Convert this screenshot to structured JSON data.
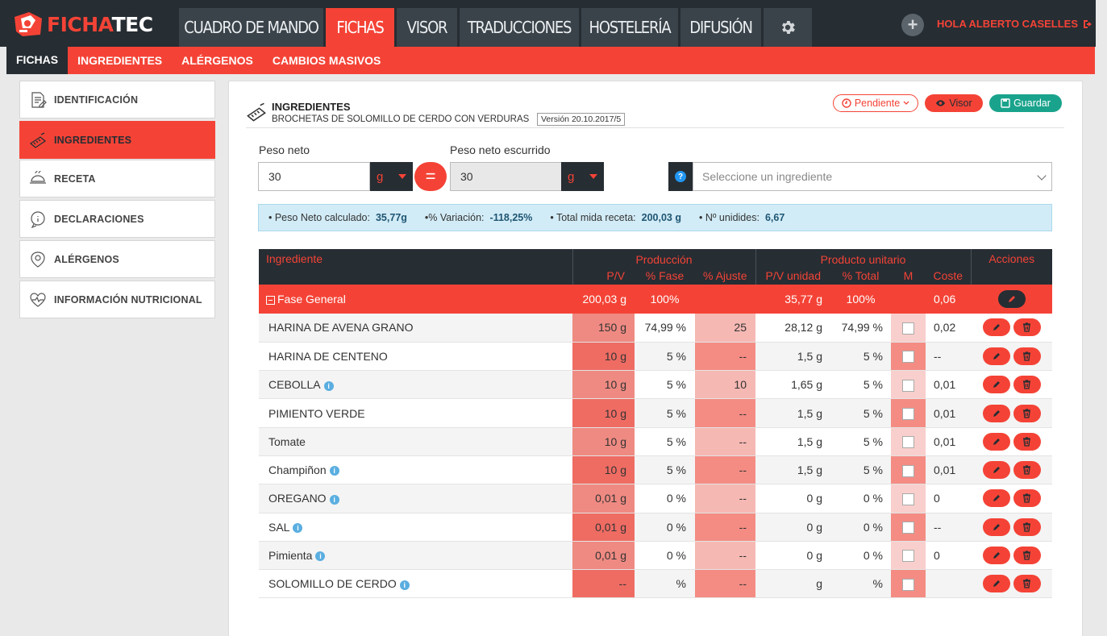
{
  "logo": {
    "part1": "FICHA",
    "part2": "TEC"
  },
  "main_nav": [
    "CUADRO DE MANDO",
    "FICHAS",
    "VISOR",
    "TRADUCCIONES",
    "HOSTELERÍA",
    "DIFUSIÓN"
  ],
  "user": {
    "greeting": "HOLA ALBERTO CASELLES"
  },
  "sub_nav": [
    "FICHAS",
    "INGREDIENTES",
    "ALÉRGENOS",
    "CAMBIOS MASIVOS"
  ],
  "sidebar": [
    "IDENTIFICACIÓN",
    "INGREDIENTES",
    "RECETA",
    "DECLARACIONES",
    "ALÉRGENOS",
    "INFORMACIÓN NUTRICIONAL"
  ],
  "header": {
    "title": "INGREDIENTES",
    "subtitle": "BROCHETAS DE SOLOMILLO DE CERDO CON VERDURAS",
    "version": "Versión 20.10.2017/5",
    "status": "Pendiente",
    "visor": "Visor",
    "guardar": "Guardar"
  },
  "form": {
    "peso_neto_label": "Peso neto",
    "peso_neto": "30",
    "unit1": "g",
    "eq": "=",
    "escurrido_label": "Peso neto escurrido",
    "escurrido": "30",
    "unit2": "g",
    "select_placeholder": "Seleccione un ingrediente"
  },
  "info": {
    "l1": "• Peso Neto calculado:",
    "v1": "35,77g",
    "l2": "•% Variación:",
    "v2": "-118,25%",
    "l3": "• Total mida receta:",
    "v3": "200,03 g",
    "l4": "• Nº unidides:",
    "v4": "6,67"
  },
  "table": {
    "h_ingrediente": "Ingrediente",
    "h_produccion": "Producción",
    "h_producto": "Producto unitario",
    "h_acciones": "Acciones",
    "h_pv": "P/V",
    "h_fase": "% Fase",
    "h_ajuste": "% Ajuste",
    "h_pvu": "P/V unidad",
    "h_total": "% Total",
    "h_m": "M",
    "h_coste": "Coste",
    "fase": {
      "name": "Fase General",
      "pv": "200,03 g",
      "fase": "100%",
      "pvu": "35,77 g",
      "total": "100%",
      "coste": "0,06"
    },
    "rows": [
      {
        "name": "HARINA DE AVENA GRANO",
        "pv": "150 g",
        "fase": "74,99 %",
        "ajuste": "25",
        "pvu": "28,12 g",
        "total": "74,99 %",
        "coste": "0,02"
      },
      {
        "name": "HARINA DE CENTENO",
        "pv": "10 g",
        "fase": "5 %",
        "ajuste": "--",
        "pvu": "1,5 g",
        "total": "5 %",
        "coste": "--"
      },
      {
        "name": "CEBOLLA",
        "pv": "10 g",
        "fase": "5 %",
        "ajuste": "10",
        "pvu": "1,65 g",
        "total": "5 %",
        "coste": "0,01"
      },
      {
        "name": "PIMIENTO VERDE",
        "pv": "10 g",
        "fase": "5 %",
        "ajuste": "--",
        "pvu": "1,5 g",
        "total": "5 %",
        "coste": "0,01"
      },
      {
        "name": "Tomate",
        "pv": "10 g",
        "fase": "5 %",
        "ajuste": "--",
        "pvu": "1,5 g",
        "total": "5 %",
        "coste": "0,01"
      },
      {
        "name": "Champiñon",
        "pv": "10 g",
        "fase": "5 %",
        "ajuste": "--",
        "pvu": "1,5 g",
        "total": "5 %",
        "coste": "0,01"
      },
      {
        "name": "OREGANO",
        "pv": "0,01 g",
        "fase": "0 %",
        "ajuste": "--",
        "pvu": "0 g",
        "total": "0 %",
        "coste": "0"
      },
      {
        "name": "SAL",
        "pv": "0,01 g",
        "fase": "0 %",
        "ajuste": "--",
        "pvu": "0 g",
        "total": "0 %",
        "coste": "--"
      },
      {
        "name": "Pimienta",
        "pv": "0,01 g",
        "fase": "0 %",
        "ajuste": "--",
        "pvu": "0 g",
        "total": "0 %",
        "coste": "0"
      },
      {
        "name": "SOLOMILLO DE CERDO",
        "pv": "--",
        "fase": "%",
        "ajuste": "--",
        "pvu": "g",
        "total": "%",
        "coste": ""
      }
    ]
  }
}
